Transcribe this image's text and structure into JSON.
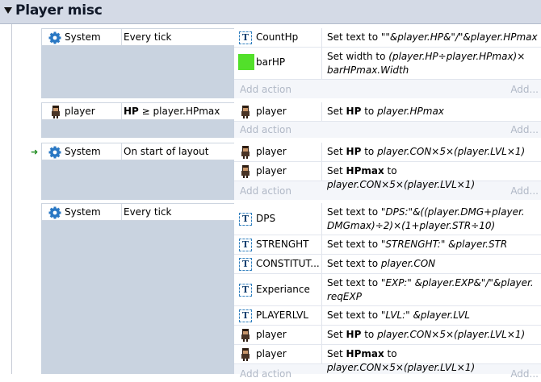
{
  "group": {
    "title": "Player misc"
  },
  "colors": {
    "group_header": "#d4dae6",
    "condition_bg": "#c9d3e0",
    "add_text": "#b0b8c6",
    "bar_green": "#52e02a",
    "gear_blue": "#2a78c4"
  },
  "add_action_label": "Add action",
  "add_label": "Add...",
  "events": [
    {
      "condition": {
        "object": "System",
        "icon": "gear-icon",
        "text": "Every tick"
      },
      "actions": [
        {
          "object": "CountHp",
          "icon": "text-icon",
          "parts": [
            "Set text to ",
            "\"\"&player.HP&\"/\"&player.HPmax"
          ]
        },
        {
          "object": "barHP",
          "icon": "green-bar-icon",
          "parts": [
            "Set width to ",
            "(player.HP÷player.HPmax)× barHPmax.Width"
          ]
        }
      ]
    },
    {
      "condition": {
        "object": "player",
        "icon": "player-icon",
        "bold": "HP",
        "text": " ≥ player.HPmax"
      },
      "actions": [
        {
          "object": "player",
          "icon": "player-icon",
          "parts": [
            "Set ",
            "HP",
            " to ",
            "player.HPmax"
          ]
        }
      ]
    },
    {
      "condition": {
        "object": "System",
        "icon": "gear-icon",
        "text": "On start of layout"
      },
      "actions": [
        {
          "object": "player",
          "icon": "player-icon",
          "parts": [
            "Set ",
            "HP",
            " to ",
            "player.CON×5×(player.LVL×1)"
          ]
        },
        {
          "object": "player",
          "icon": "player-icon",
          "parts": [
            "Set ",
            "HPmax",
            " to ",
            "player.CON×5×(player.LVL×1)"
          ]
        }
      ]
    },
    {
      "condition": {
        "object": "System",
        "icon": "gear-icon",
        "text": "Every tick"
      },
      "actions": [
        {
          "object": "DPS",
          "icon": "text-icon",
          "parts": [
            "Set text to ",
            "\"DPS:\"&((player.DMG+player. DMGmax)÷2)×(1+player.STR÷10)"
          ]
        },
        {
          "object": "STRENGHT",
          "icon": "text-icon",
          "parts": [
            "Set text to ",
            "\"STRENGHT:\" &player.STR"
          ]
        },
        {
          "object": "CONSTITUT...",
          "icon": "text-icon",
          "parts": [
            "Set text to ",
            "player.CON"
          ]
        },
        {
          "object": "Experiance",
          "icon": "text-icon",
          "parts": [
            "Set text to ",
            "\"EXP:\" &player.EXP&\"/\"&player. reqEXP"
          ]
        },
        {
          "object": "PLAYERLVL",
          "icon": "text-icon",
          "parts": [
            "Set text to ",
            "\"LVL:\" &player.LVL"
          ]
        },
        {
          "object": "player",
          "icon": "player-icon",
          "parts": [
            "Set ",
            "HP",
            " to ",
            "player.CON×5×(player.LVL×1)"
          ]
        },
        {
          "object": "player",
          "icon": "player-icon",
          "parts": [
            "Set ",
            "HPmax",
            " to ",
            "player.CON×5×(player.LVL×1)"
          ]
        }
      ]
    }
  ]
}
